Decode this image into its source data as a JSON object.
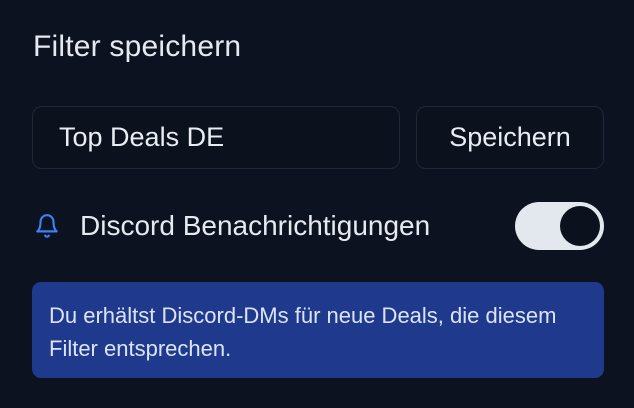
{
  "title": "Filter speichern",
  "filter_name": {
    "value": "Top Deals DE",
    "placeholder": ""
  },
  "save_label": "Speichern",
  "notifications": {
    "icon": "bell-icon",
    "label": "Discord Benachrichtigungen",
    "enabled": true
  },
  "info_text": "Du erhältst Discord-DMs für neue Deals, die diesem Filter entsprechen.",
  "colors": {
    "background": "#0c1220",
    "accent_icon": "#3b82f6",
    "info_box": "#1f3a8c",
    "toggle_track": "#e3e7ee"
  }
}
